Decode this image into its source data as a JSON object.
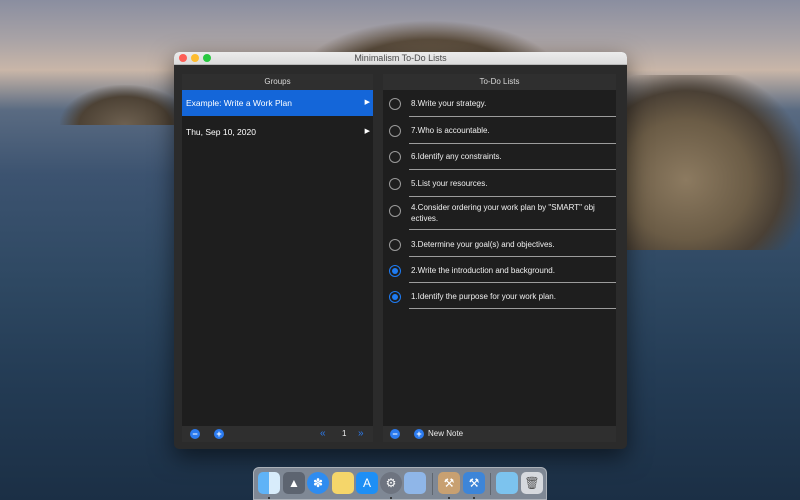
{
  "window": {
    "title": "Minimalism To-Do Lists"
  },
  "groups": {
    "header": "Groups",
    "items": [
      {
        "label": "Example: Write a Work Plan",
        "selected": true
      },
      {
        "label": "Thu, Sep 10, 2020",
        "selected": false
      }
    ],
    "footer": {
      "remove_icon": "minus-circle-icon",
      "add_icon": "plus-circle-icon",
      "prev_icon": "double-chevron-left-icon",
      "page": "1",
      "next_icon": "double-chevron-right-icon"
    }
  },
  "todos": {
    "header": "To-Do Lists",
    "items": [
      {
        "text": "8.Write your strategy.",
        "done": false
      },
      {
        "text": "7.Who is accountable.",
        "done": false
      },
      {
        "text": "6.Identify any constraints.",
        "done": false
      },
      {
        "text": "5.List your resources.",
        "done": false
      },
      {
        "text": "4.Consider ordering your work plan by \"SMART\" obj ectives.",
        "done": false
      },
      {
        "text": "3.Determine your goal(s) and objectives.",
        "done": false
      },
      {
        "text": "2.Write the introduction and background.",
        "done": true
      },
      {
        "text": "1.Identify the purpose for your work plan.",
        "done": true
      }
    ],
    "footer": {
      "remove_icon": "minus-circle-icon",
      "add_icon": "plus-circle-icon",
      "new_note_label": "New Note"
    }
  },
  "colors": {
    "accent": "#1466d9",
    "button_blue": "#2b7bf0",
    "pane_bg": "#1e1e1e",
    "window_bg": "#2b2b2b"
  },
  "dock": {
    "icons": [
      "finder-icon",
      "launchpad-icon",
      "safari-icon",
      "notes-icon",
      "app-store-icon",
      "system-preferences-icon",
      "preview-icon",
      "xcode-icon",
      "instruments-icon",
      "downloads-folder-icon",
      "trash-icon"
    ]
  }
}
